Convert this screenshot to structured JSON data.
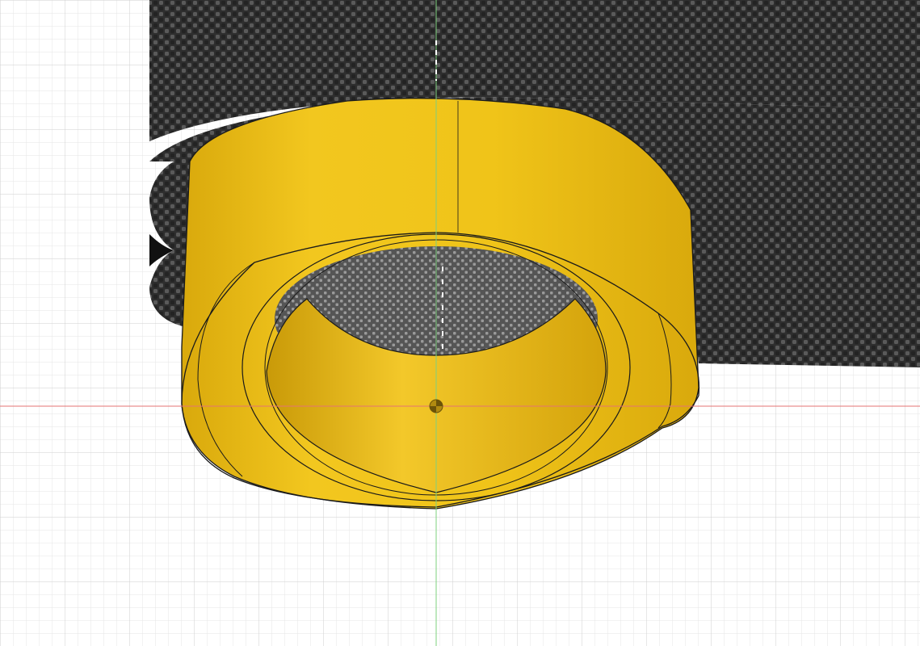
{
  "viewport": {
    "background_color": "#ffffff",
    "grid_minor_color": "#e6e6e6",
    "grid_major_color": "#cfcfcf",
    "x_axis_color": "#e57373",
    "y_axis_color": "#7ed07e"
  },
  "materials": {
    "carbon_fiber_base": "#3a3a3a",
    "carbon_fiber_dark": "#1a1a1a",
    "carbon_fiber_light": "#8c8c8c",
    "highlight_part_fill": "#f0c419",
    "highlight_part_shade": "#d9a90c",
    "highlight_part_edge": "#1a1a1a"
  },
  "scene_objects": [
    {
      "name": "carbon-fiber-body"
    },
    {
      "name": "yellow-ring-part"
    },
    {
      "name": "origin-marker"
    }
  ]
}
